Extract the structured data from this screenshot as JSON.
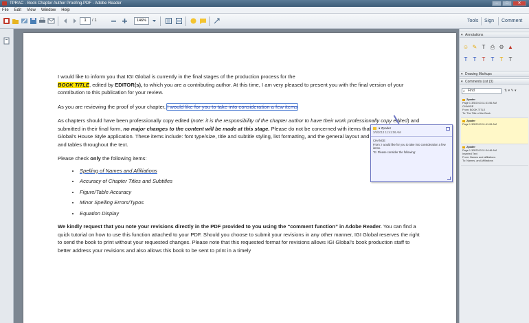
{
  "window": {
    "title": "TPRAC - Book Chapter Author Proofing.PDF - Adobe Reader",
    "buttons": [
      "–",
      "□",
      "✕"
    ]
  },
  "menubar": [
    "File",
    "Edit",
    "View",
    "Window",
    "Help"
  ],
  "toolbar": {
    "page_current": "1",
    "page_count": "/ 1",
    "zoom": "146%",
    "tabs": {
      "tools": "Tools",
      "sign": "Sign",
      "comment": "Comment"
    }
  },
  "document": {
    "p1_a": "I would like to inform you that IGI Global is currently in the final stages of the production process for the",
    "p1_booktitle": "BOOK TITLE",
    "p1_b": ", edited by ",
    "p1_editor": "EDITOR(s),",
    "p1_c": " to which you are a contributing author.  At this time, I am very pleased to present you with the final version of your contribution to this publication for your review.",
    "p2_a": "As you are reviewing the proof of your chapter, ",
    "p2_strike": "I would like for you to take into consideration a few items",
    "p3_a": "As chapters should have been professionally copy edited (",
    "p3_note": "note: it is the responsibility of the chapter author to have their work professionally copy edited",
    "p3_b": ") and submitted in their final form, ",
    "p3_nomajor": "no major changes to the content will be made at this stage.",
    "p3_c": "  Please do not be concerned with items that are part of IGI Global's House Style application. These items include: font type/size, title and subtitle styling, list formatting, and the general layout and placement of figures and tables throughout the text.",
    "p4_a": "Please check ",
    "p4_only": "only",
    "p4_b": " the following items:",
    "items": [
      "Spelling of Names and Affiliations",
      "Accuracy of Chapter Titles and Subtitles",
      "Figure/Table Accuracy",
      "Minor Spelling Errors/Typos",
      "Equation Display"
    ],
    "p5_bold": "We kindly request that you note your revisions directly in the PDF provided to you using the “comment function” in Adobe Reader.",
    "p5_rest": " You can find a quick tutorial on how to use this function attached to your PDF. Should you choose to submit your revisions in any other manner, IGI Global reserves the right to send the book to print without your requested changes. Please note that this requested format for revisions allows IGI Global's book production staff to better address your revisions and also allows this book to be sent to print in a timely"
  },
  "popup": {
    "author": "▾ Zpoder",
    "date": "3/5/2013 11:41:06 AM",
    "body_1": "CHANGE",
    "body_2": "From: I would like for you to take into consideration a few items.",
    "body_3": "To: Please consider the following:"
  },
  "right_pane": {
    "annotations_header": "Annotations",
    "drawing_header": "Drawing Markups",
    "comments_header": "Comments List (3)",
    "find_placeholder": "Find",
    "tool_glyphs_row1": [
      "☺",
      "✎",
      "T",
      "⎙",
      "⚙",
      "▲"
    ],
    "tool_glyphs_row2": [
      "T",
      "T",
      "T",
      "T",
      "T",
      "T"
    ],
    "comments": [
      {
        "name": "Zpoder",
        "meta": "Page 1  3/5/2013 11:31:56 AM",
        "line1": "CHANGE",
        "line2": "From: BOOK TITLE",
        "line3": "To: The Title of the Book",
        "selected": false
      },
      {
        "name": "Zpoder",
        "meta": "Page 1  3/5/2013 11:41:06 AM",
        "line1": "",
        "line2": "",
        "line3": "",
        "selected": true
      },
      {
        "name": "Zpoder",
        "meta": "Page 1  3/5/2013 11:34:46 AM",
        "line1": "Inserted Text",
        "line2": "From: Names and affiliations",
        "line3": "To: Names, and Affiliations",
        "selected": false
      }
    ]
  },
  "colors": {
    "highlight": "#ffe300",
    "strike": "#2a52be",
    "popup_bg": "#eef0ff",
    "selected_comment": "#fff8c8"
  }
}
